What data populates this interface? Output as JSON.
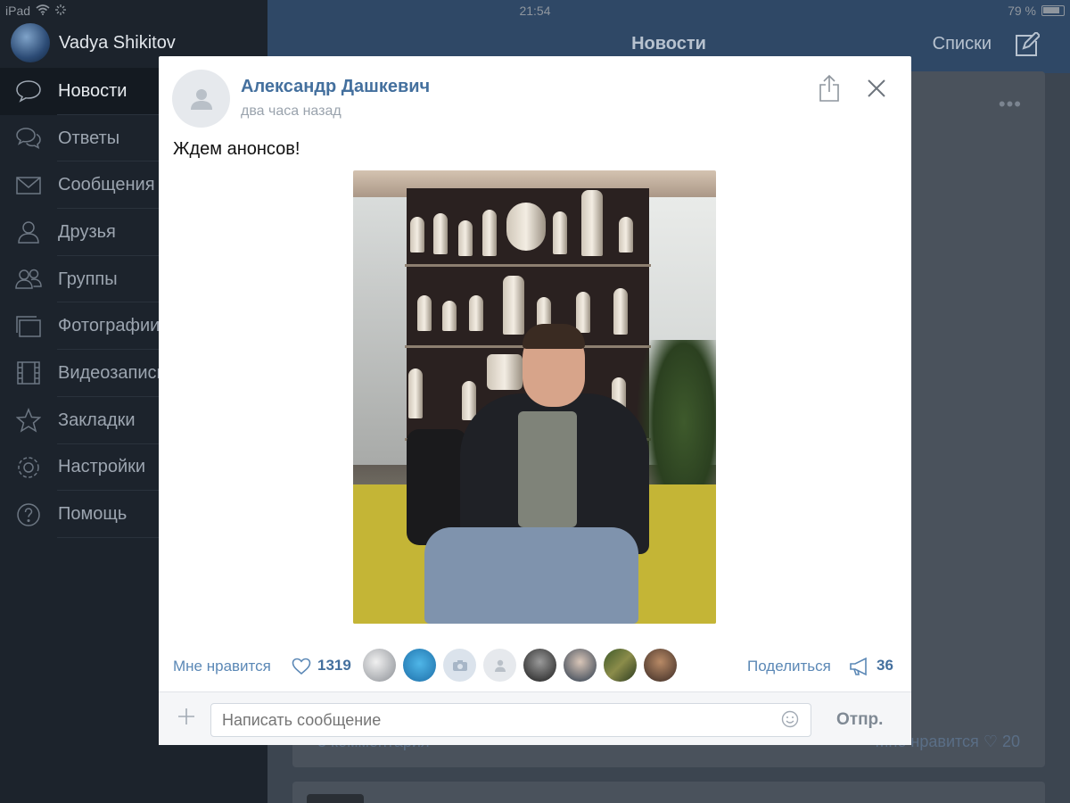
{
  "status_bar": {
    "device": "iPad",
    "time": "21:54",
    "battery": "79 %"
  },
  "sidebar": {
    "user_name": "Vadya Shikitov",
    "items": [
      {
        "label": "Новости",
        "icon": "speech-bubble-icon",
        "active": true
      },
      {
        "label": "Ответы",
        "icon": "chat-bubbles-icon",
        "active": false
      },
      {
        "label": "Сообщения",
        "icon": "envelope-icon",
        "active": false
      },
      {
        "label": "Друзья",
        "icon": "person-icon",
        "active": false
      },
      {
        "label": "Группы",
        "icon": "people-icon",
        "active": false
      },
      {
        "label": "Фотографии",
        "icon": "photos-icon",
        "active": false
      },
      {
        "label": "Видеозаписи",
        "icon": "film-icon",
        "active": false
      },
      {
        "label": "Закладки",
        "icon": "star-icon",
        "active": false
      },
      {
        "label": "Настройки",
        "icon": "gear-icon",
        "active": false
      },
      {
        "label": "Помощь",
        "icon": "question-icon",
        "active": false
      }
    ]
  },
  "navbar": {
    "title": "Новости",
    "lists_label": "Списки"
  },
  "background_post": {
    "comments_label": "3 комментария",
    "like_label": "Мне нравится",
    "like_count": "20"
  },
  "modal": {
    "author_name": "Александр Дашкевич",
    "time": "два часа назад",
    "text": "Ждем анонсов!",
    "like_label": "Мне нравится",
    "like_count": "1319",
    "share_label": "Поделиться",
    "share_count": "36",
    "composer_placeholder": "Написать сообщение",
    "send_label": "Отпр."
  }
}
